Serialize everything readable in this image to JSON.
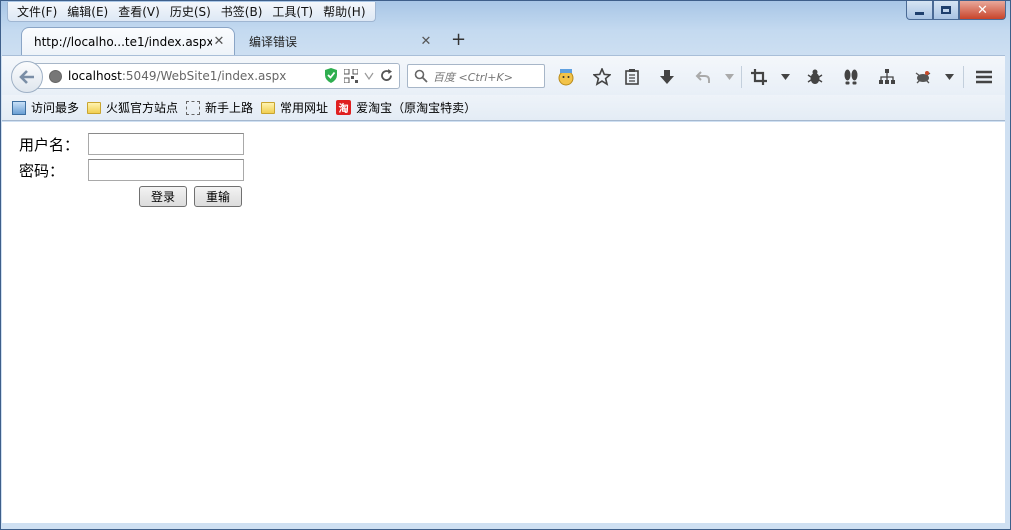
{
  "menu": {
    "items": [
      "文件(F)",
      "编辑(E)",
      "查看(V)",
      "历史(S)",
      "书签(B)",
      "工具(T)",
      "帮助(H)"
    ]
  },
  "tabs": [
    {
      "label": "http://localho...te1/index.aspx",
      "active": true
    },
    {
      "label": "编译错误",
      "active": false
    }
  ],
  "urlbar": {
    "host": "localhost",
    "rest": ":5049/WebSite1/index.aspx"
  },
  "search": {
    "placeholder": "百度 <Ctrl+K>"
  },
  "bookmarks": [
    {
      "label": "访问最多",
      "icon": "most-visited-icon"
    },
    {
      "label": "火狐官方站点",
      "icon": "folder-icon"
    },
    {
      "label": "新手上路",
      "icon": "page-icon"
    },
    {
      "label": "常用网址",
      "icon": "folder-icon"
    },
    {
      "label": "爱淘宝（原淘宝特卖）",
      "icon": "taobao-icon"
    }
  ],
  "taobao_glyph": "淘",
  "form": {
    "username_label": "用户名：",
    "username_value": "",
    "password_label": "密码：",
    "password_value": "",
    "login_button": "登录",
    "reset_button": "重输"
  },
  "colors": {
    "chrome_blue": "#b9d1ea",
    "close_red": "#c8442b"
  }
}
